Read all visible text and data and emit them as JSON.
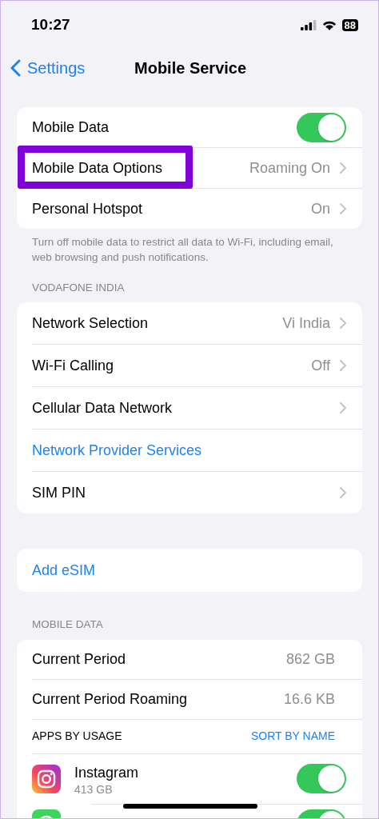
{
  "status_bar": {
    "time": "10:27",
    "battery": "88"
  },
  "nav": {
    "back": "Settings",
    "title": "Mobile Service"
  },
  "groups": [
    {
      "rows": [
        {
          "kind": "toggle",
          "label": "Mobile Data",
          "on": true,
          "highlighted": false
        },
        {
          "kind": "detail",
          "label": "Mobile Data Options",
          "value": "Roaming On",
          "highlighted": true
        },
        {
          "kind": "detail",
          "label": "Personal Hotspot",
          "value": "On",
          "highlighted": false
        }
      ],
      "footer": "Turn off mobile data to restrict all data to Wi-Fi, including email, web browsing and push notifications."
    },
    {
      "header": "VODAFONE INDIA",
      "rows": [
        {
          "kind": "detail",
          "label": "Network Selection",
          "value": "Vi India",
          "highlighted": false
        },
        {
          "kind": "detail",
          "label": "Wi-Fi Calling",
          "value": "Off",
          "highlighted": false
        },
        {
          "kind": "detail",
          "label": "Cellular Data Network",
          "highlighted": false
        },
        {
          "kind": "link",
          "label": "Network Provider Services",
          "highlighted": false
        },
        {
          "kind": "detail",
          "label": "SIM PIN",
          "highlighted": false
        }
      ]
    },
    {
      "rows": [
        {
          "kind": "link",
          "label": "Add eSIM",
          "highlighted": false
        }
      ]
    },
    {
      "header": "MOBILE DATA",
      "rows": [
        {
          "kind": "stat",
          "label": "Current Period",
          "value": "862 GB",
          "highlighted": false
        },
        {
          "kind": "stat",
          "label": "Current Period Roaming",
          "value": "16.6 KB",
          "highlighted": false
        },
        {
          "kind": "subheader",
          "label": "APPS BY USAGE",
          "action": "SORT BY NAME",
          "highlighted": false
        },
        {
          "kind": "app",
          "label": "Instagram",
          "value": "413 GB",
          "on": true
        },
        {
          "kind": "app",
          "on": true
        }
      ]
    }
  ]
}
